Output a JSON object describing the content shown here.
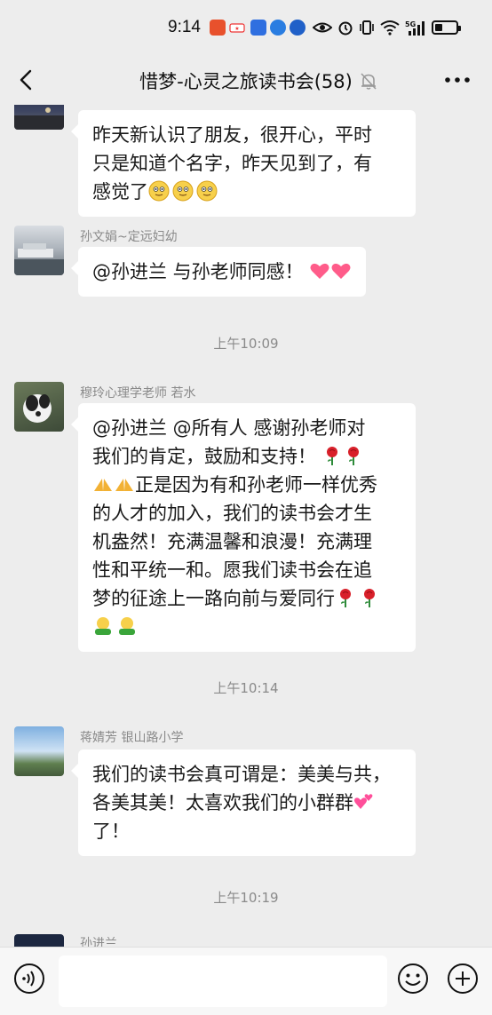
{
  "status": {
    "time": "9:14",
    "network": "5G"
  },
  "header": {
    "title": "惜梦-心灵之旅读书会(58)"
  },
  "messages": [
    {
      "sender": "",
      "lines": [
        "昨天新认识了朋友，很开心，平时",
        "只是知道个名字，昨天见到了，有",
        "感觉了"
      ],
      "emoji_tail": [
        "smile",
        "smile",
        "smile"
      ]
    },
    {
      "sender": "孙文娟~定远妇幼",
      "lines": [
        "@孙进兰  与孙老师同感！"
      ],
      "emoji_tail": [
        "heart",
        "heart"
      ]
    },
    {
      "sender": "穆玲心理学老师  若水",
      "lines": [
        "@孙进兰 @所有人  感谢孙老师对",
        "我们的肯定，鼓励和支持！",
        "正是因为有和孙老师一样优秀",
        "的人才的加入，我们的读书会才生",
        "机盎然！充满温馨和浪漫！充满理",
        "性和平统一和。愿我们读书会在追",
        "梦的征途上一路向前与爱同行"
      ]
    },
    {
      "sender": "蒋婧芳  银山路小学",
      "lines": [
        "我们的读书会真可谓是：美美与共，",
        "各美其美！太喜欢我们的小群群",
        "了！"
      ]
    },
    {
      "sender": "孙进兰",
      "lines": []
    }
  ],
  "timestamps": [
    "上午10:09",
    "上午10:14",
    "上午10:19"
  ],
  "input": {
    "placeholder": ""
  },
  "icons": [
    "back-icon",
    "mute-bell-icon",
    "more-icon",
    "voice-icon",
    "emoji-icon",
    "plus-icon"
  ]
}
